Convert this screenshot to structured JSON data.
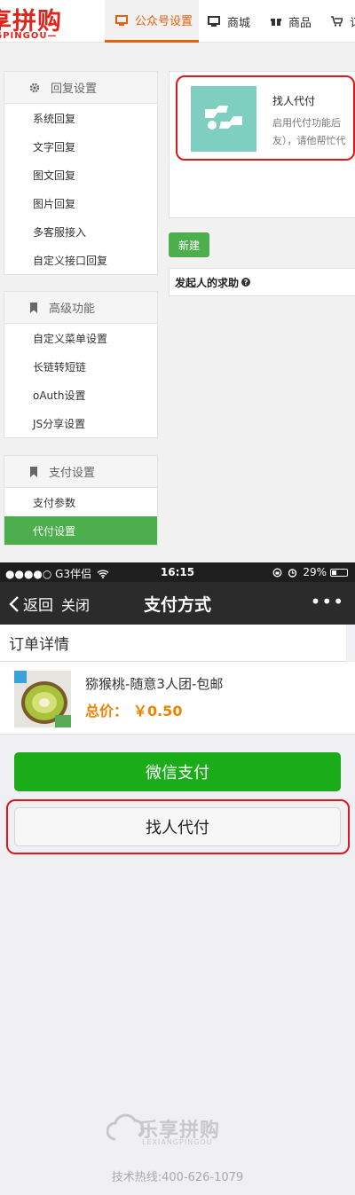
{
  "admin": {
    "logo": {
      "main": "享拼购",
      "sub": "GPINGOU—"
    },
    "nav": [
      {
        "label": "公众号设置",
        "icon": "monitor-icon"
      },
      {
        "label": "商城",
        "icon": "monitor-icon"
      },
      {
        "label": "商品",
        "icon": "gift-icon"
      },
      {
        "label": "订",
        "icon": "cart-icon"
      }
    ],
    "sidebar": {
      "reply": {
        "title": "回复设置",
        "icon": "gear-icon",
        "items": [
          "系统回复",
          "文字回复",
          "图文回复",
          "图片回复",
          "多客服接入",
          "自定义接口回复"
        ]
      },
      "advanced": {
        "title": "高级功能",
        "icon": "bookmark-icon",
        "items": [
          "自定义菜单设置",
          "长链转短链",
          "oAuth设置",
          "JS分享设置"
        ]
      },
      "payment": {
        "title": "支付设置",
        "icon": "bookmark-icon",
        "items": [
          "支付参数",
          "代付设置"
        ],
        "active": "代付设置"
      }
    },
    "card": {
      "title": "找人代付",
      "desc": "启用代付功能后友），请他帮忙代"
    },
    "new_button": "新建",
    "help_bar": "发起人的求助",
    "colors": {
      "accent": "#e8600b",
      "active_green": "#4cae4c",
      "highlight": "#e0161b"
    }
  },
  "phone": {
    "status": {
      "carrier": "●●●●○ G3伴侣",
      "time": "16:15",
      "battery": "29%"
    },
    "navbar": {
      "back": "返回",
      "close": "关闭",
      "title": "支付方式",
      "more": "•••"
    },
    "order_title": "订单详情",
    "product": {
      "name": "猕猴桃-随意3人团-包邮",
      "price_label": "总价：",
      "price": "￥0.50"
    },
    "wechat_pay": "微信支付",
    "friend_pay": "找人代付",
    "footer": {
      "logo": "乐享拼购",
      "logo_sub": "LEXIANGPINGOU",
      "hotline": "技术热线:400-626-1079"
    },
    "colors": {
      "wechat_green": "#1aad19",
      "price_orange": "#f08200"
    }
  }
}
